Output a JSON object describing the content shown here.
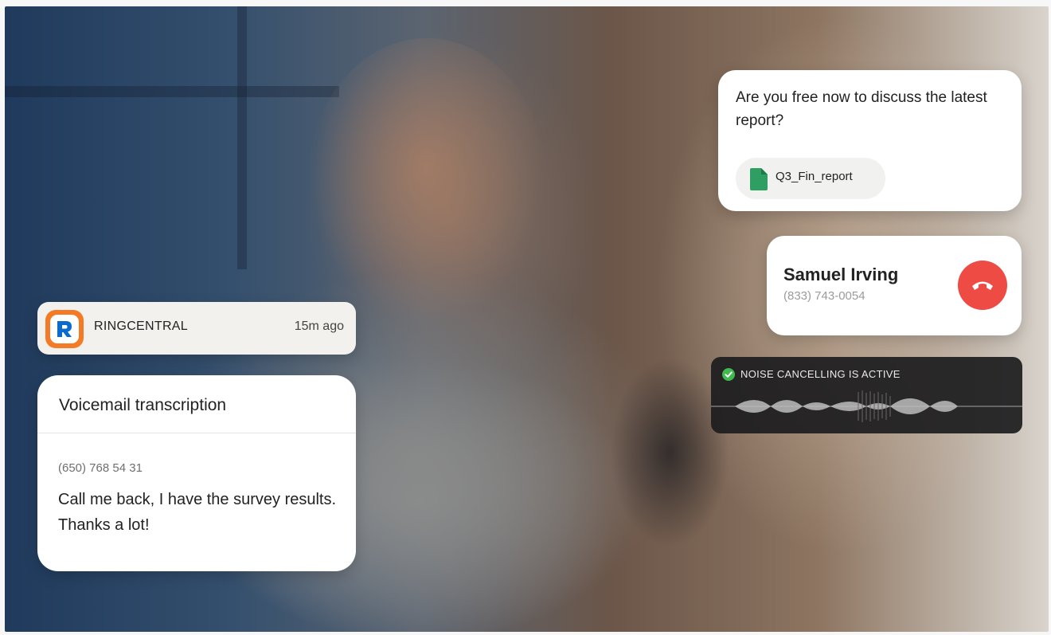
{
  "chat": {
    "message": "Are you free now to discuss the latest report?",
    "attachment_name": "Q3_Fin_report",
    "attachment_icon": "spreadsheet-file-icon",
    "attachment_color": "#2e9e63"
  },
  "call": {
    "caller_name": "Samuel Irving",
    "caller_number": "(833) 743-0054",
    "hangup_icon": "phone-hangup-icon",
    "hangup_color": "#ee4b45"
  },
  "noise": {
    "status_text": "NOISE CANCELLING IS ACTIVE",
    "status_icon": "check-circle-icon",
    "status_color": "#3fb950"
  },
  "notification": {
    "brand": "RINGCENTRAL",
    "time": "15m ago",
    "logo_icon": "ringcentral-logo-icon",
    "logo_color": "#f47a25",
    "logo_letter_color": "#0b6bcb"
  },
  "voicemail": {
    "title": "Voicemail transcription",
    "number": "(650) 768 54 31",
    "message": "Call me back, I have the survey results. Thanks a lot!"
  }
}
